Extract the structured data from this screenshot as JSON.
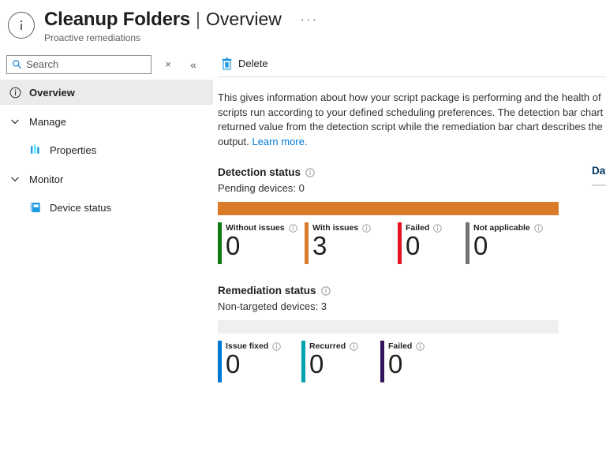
{
  "header": {
    "icon": "info-circle-icon",
    "title": "Cleanup Folders",
    "separator": "|",
    "section": "Overview",
    "more_label": "···",
    "subtitle": "Proactive remediations"
  },
  "search": {
    "placeholder": "Search",
    "value": "",
    "icon": "search-icon",
    "close_icon": "×",
    "collapse_icon": "«"
  },
  "toolbar": {
    "items": [
      {
        "label": "Delete",
        "icon": "trash-icon"
      }
    ]
  },
  "sidebar": {
    "items": [
      {
        "label": "Overview",
        "icon": "info-circle-icon",
        "type": "item",
        "selected": true
      },
      {
        "label": "Manage",
        "icon": "chevron-down-icon",
        "type": "group",
        "expanded": true
      },
      {
        "label": "Properties",
        "icon": "bar-chart-icon",
        "type": "child"
      },
      {
        "label": "Monitor",
        "icon": "chevron-down-icon",
        "type": "group",
        "expanded": true
      },
      {
        "label": "Device status",
        "icon": "device-icon",
        "type": "child"
      }
    ]
  },
  "content": {
    "intro": {
      "line1": "This gives information about how your script package is performing and the health of",
      "line2": "scripts run according to your defined scheduling preferences. The detection bar chart",
      "line3": "returned value from the detection script while the remediation bar chart describes the",
      "line4_prefix": "output. ",
      "link_label": "Learn more."
    },
    "right_panel": {
      "title": "Da"
    }
  },
  "chart_data": [
    {
      "type": "bar",
      "title": "Detection status",
      "subtitle": "Pending devices: 0",
      "info_icon": "info-icon",
      "orientation": "horizontal-stacked",
      "track_color": "#efefef",
      "total": 3,
      "categories": [
        "Without issues",
        "With issues",
        "Failed",
        "Not applicable"
      ],
      "values": [
        0,
        3,
        0,
        0
      ],
      "colors": [
        "#107C10",
        "#D97B29",
        "#E81123",
        "#737373"
      ],
      "segments": [
        {
          "name": "With issues",
          "value": 3,
          "percent": 100,
          "color": "#D97B29"
        }
      ],
      "legend_position": "below",
      "grid": false
    },
    {
      "type": "bar",
      "title": "Remediation status",
      "subtitle": "Non-targeted devices: 3",
      "info_icon": "info-icon",
      "orientation": "horizontal-stacked",
      "track_color": "#efefef",
      "total": 0,
      "categories": [
        "Issue fixed",
        "Recurred",
        "Failed"
      ],
      "values": [
        0,
        0,
        0
      ],
      "colors": [
        "#0078D4",
        "#00A2AD",
        "#32145A"
      ],
      "segments": [],
      "legend_position": "below",
      "grid": false
    }
  ]
}
